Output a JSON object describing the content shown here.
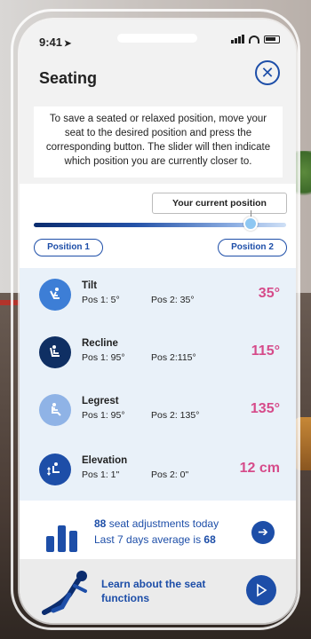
{
  "status_bar": {
    "time": "9:41"
  },
  "header": {
    "title": "Seating",
    "close_icon": "close-icon"
  },
  "instructions": "To save a seated or relaxed position, move your seat to the desired position and press the corresponding button. The slider will then indicate which position you are currently closer to.",
  "positions": {
    "current_label": "Your current position",
    "position1_label": "Position 1",
    "position2_label": "Position 2",
    "slider_value": 0.86
  },
  "adjustments": [
    {
      "icon": "tilt-icon",
      "name": "Tilt",
      "pos1": "Pos 1: 5°",
      "pos2": "Pos 2: 35°",
      "value": "35°"
    },
    {
      "icon": "recline-icon",
      "name": "Recline",
      "pos1": "Pos 1: 95°",
      "pos2": "Pos 2:115°",
      "value": "115°"
    },
    {
      "icon": "legrest-icon",
      "name": "Legrest",
      "pos1": "Pos 1: 95°",
      "pos2": "Pos 2: 135°",
      "value": "135°"
    },
    {
      "icon": "elevation-icon",
      "name": "Elevation",
      "pos1": "Pos 1: 1\"",
      "pos2": "Pos 2: 0\"",
      "value": "12 cm"
    }
  ],
  "stats": {
    "count": "88",
    "line1_suffix": "seat adjustments today",
    "line2_prefix": "Last 7 days average is",
    "average": "68"
  },
  "learn": {
    "label": "Learn about the seat functions"
  },
  "colors": {
    "accent": "#1d4ea8",
    "value": "#d64b8a",
    "panel": "#e9f1f9"
  }
}
